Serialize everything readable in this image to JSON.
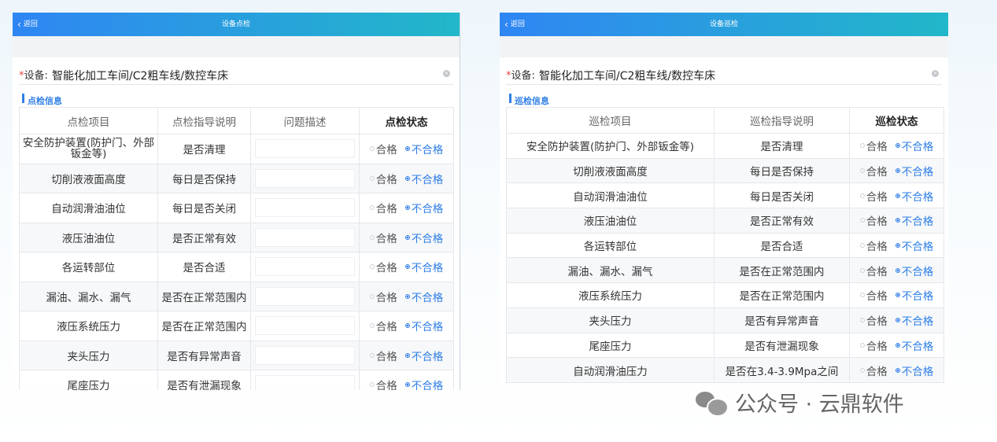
{
  "left": {
    "back_label": "返回",
    "title": "设备点检",
    "device_label": "设备:",
    "device_required": "*",
    "device_value": "智能化加工车间/C2粗车线/数控车床",
    "section_title": "点检信息",
    "columns": [
      "点检项目",
      "点检指导说明",
      "问题描述",
      "点检状态"
    ],
    "option_pass": "合格",
    "option_fail": "不合格",
    "rows": [
      {
        "item": "安全防护装置(防护门、外部钣金等)",
        "guide": "是否清理"
      },
      {
        "item": "切削液液面高度",
        "guide": "每日是否保持"
      },
      {
        "item": "自动润滑油油位",
        "guide": "每日是否关闭"
      },
      {
        "item": "液压油油位",
        "guide": "是否正常有效"
      },
      {
        "item": "各运转部位",
        "guide": "是否合适"
      },
      {
        "item": "漏油、漏水、漏气",
        "guide": "是否在正常范围内"
      },
      {
        "item": "液压系统压力",
        "guide": "是否在正常范围内"
      },
      {
        "item": "夹头压力",
        "guide": "是否有异常声音"
      },
      {
        "item": "尾座压力",
        "guide": "是否有泄漏现象"
      }
    ]
  },
  "right": {
    "back_label": "返回",
    "title": "设备巡检",
    "device_label": "设备:",
    "device_required": "*",
    "device_value": "智能化加工车间/C2粗车线/数控车床",
    "section_title": "巡检信息",
    "columns": [
      "巡检项目",
      "巡检指导说明",
      "巡检状态"
    ],
    "option_pass": "合格",
    "option_fail": "不合格",
    "rows": [
      {
        "item": "安全防护装置(防护门、外部钣金等)",
        "guide": "是否清理"
      },
      {
        "item": "切削液液面高度",
        "guide": "每日是否保持"
      },
      {
        "item": "自动润滑油油位",
        "guide": "每日是否关闭"
      },
      {
        "item": "液压油油位",
        "guide": "是否正常有效"
      },
      {
        "item": "各运转部位",
        "guide": "是否合适"
      },
      {
        "item": "漏油、漏水、漏气",
        "guide": "是否在正常范围内"
      },
      {
        "item": "液压系统压力",
        "guide": "是否在正常范围内"
      },
      {
        "item": "夹头压力",
        "guide": "是否有异常声音"
      },
      {
        "item": "尾座压力",
        "guide": "是否有泄漏现象"
      },
      {
        "item": "自动润滑油压力",
        "guide": "是否在3.4-3.9Mpa之间"
      }
    ]
  },
  "watermark": "公众号 · 云鼎软件",
  "colors": {
    "accent": "#2f7fe6",
    "header_start": "#2f86f3",
    "header_end": "#22b7c9"
  }
}
